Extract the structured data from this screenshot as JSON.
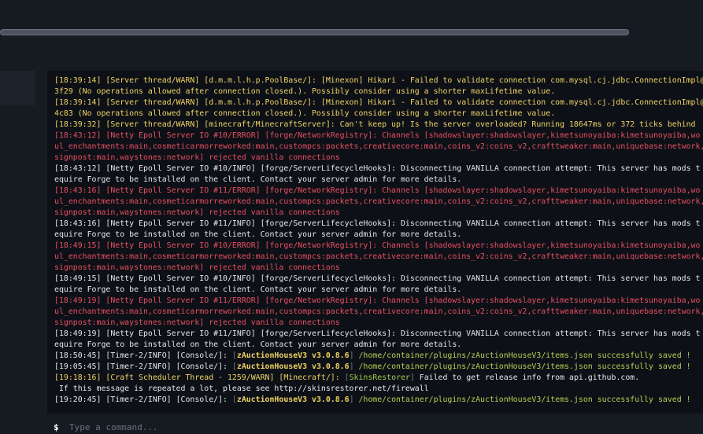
{
  "header": {
    "progress_fraction": 1.0
  },
  "console": {
    "lines": [
      {
        "kind": "warn",
        "segments": [
          {
            "text": "[18:39:14] [Server thread/WARN] [d.m.m.l.h.p.PoolBase/]: [Minexon] Hikari - Failed to validate connection com.mysql.cj.jdbc.ConnectionImpl@",
            "style": "warn"
          }
        ]
      },
      {
        "kind": "warn",
        "segments": [
          {
            "text": "3f29 (No operations allowed after connection closed.). Possibly consider using a shorter maxLifetime value.",
            "style": "warn"
          }
        ]
      },
      {
        "kind": "warn",
        "segments": [
          {
            "text": "[18:39:14] [Server thread/WARN] [d.m.m.l.h.p.PoolBase/]: [Minexon] Hikari - Failed to validate connection com.mysql.cj.jdbc.ConnectionImpl@",
            "style": "warn"
          }
        ]
      },
      {
        "kind": "warn",
        "segments": [
          {
            "text": "4c83 (No operations allowed after connection closed.). Possibly consider using a shorter maxLifetime value.",
            "style": "warn"
          }
        ]
      },
      {
        "kind": "warn",
        "segments": [
          {
            "text": "[18:39:32] [Server thread/WARN] [minecraft/MinecraftServer]: Can't keep up! Is the server overloaded? Running 18647ms or 372 ticks behind",
            "style": "warn"
          }
        ]
      },
      {
        "kind": "error",
        "segments": [
          {
            "text": "[18:43:12] [Netty Epoll Server IO #10/ERROR] [forge/NetworkRegistry]: Channels [shadowslayer:shadowslayer,kimetsunoyaiba:kimetsunoyaiba,wo",
            "style": "error"
          }
        ]
      },
      {
        "kind": "error",
        "segments": [
          {
            "text": "ul_enchantments:main,cosmeticarmorreworked:main,custompcs:packets,creativecore:main,coins_v2:coins_v2,crafttweaker:main,uniquebase:network,",
            "style": "error"
          }
        ]
      },
      {
        "kind": "error",
        "segments": [
          {
            "text": "signpost:main,waystones:network] rejected vanilla connections",
            "style": "error"
          }
        ]
      },
      {
        "kind": "info",
        "segments": [
          {
            "text": "[18:43:12] [Netty Epoll Server IO #10/INFO] [forge/ServerLifecycleHooks]: Disconnecting VANILLA connection attempt: This server has mods t",
            "style": "info"
          }
        ]
      },
      {
        "kind": "info",
        "segments": [
          {
            "text": "equire Forge to be installed on the client. Contact your server admin for more details.",
            "style": "info"
          }
        ]
      },
      {
        "kind": "error",
        "segments": [
          {
            "text": "[18:43:16] [Netty Epoll Server IO #11/ERROR] [forge/NetworkRegistry]: Channels [shadowslayer:shadowslayer,kimetsunoyaiba:kimetsunoyaiba,wo",
            "style": "error"
          }
        ]
      },
      {
        "kind": "error",
        "segments": [
          {
            "text": "ul_enchantments:main,cosmeticarmorreworked:main,custompcs:packets,creativecore:main,coins_v2:coins_v2,crafttweaker:main,uniquebase:network,",
            "style": "error"
          }
        ]
      },
      {
        "kind": "error",
        "segments": [
          {
            "text": "signpost:main,waystones:network] rejected vanilla connections",
            "style": "error"
          }
        ]
      },
      {
        "kind": "info",
        "segments": [
          {
            "text": "[18:43:16] [Netty Epoll Server IO #11/INFO] [forge/ServerLifecycleHooks]: Disconnecting VANILLA connection attempt: This server has mods t",
            "style": "info"
          }
        ]
      },
      {
        "kind": "info",
        "segments": [
          {
            "text": "equire Forge to be installed on the client. Contact your server admin for more details.",
            "style": "info"
          }
        ]
      },
      {
        "kind": "error",
        "segments": [
          {
            "text": "[18:49:15] [Netty Epoll Server IO #10/ERROR] [forge/NetworkRegistry]: Channels [shadowslayer:shadowslayer,kimetsunoyaiba:kimetsunoyaiba,wo",
            "style": "error"
          }
        ]
      },
      {
        "kind": "error",
        "segments": [
          {
            "text": "ul_enchantments:main,cosmeticarmorreworked:main,custompcs:packets,creativecore:main,coins_v2:coins_v2,crafttweaker:main,uniquebase:network,",
            "style": "error"
          }
        ]
      },
      {
        "kind": "error",
        "segments": [
          {
            "text": "signpost:main,waystones:network] rejected vanilla connections",
            "style": "error"
          }
        ]
      },
      {
        "kind": "info",
        "segments": [
          {
            "text": "[18:49:15] [Netty Epoll Server IO #10/INFO] [forge/ServerLifecycleHooks]: Disconnecting VANILLA connection attempt: This server has mods t",
            "style": "info"
          }
        ]
      },
      {
        "kind": "info",
        "segments": [
          {
            "text": "equire Forge to be installed on the client. Contact your server admin for more details.",
            "style": "info"
          }
        ]
      },
      {
        "kind": "error",
        "segments": [
          {
            "text": "[18:49:19] [Netty Epoll Server IO #11/ERROR] [forge/NetworkRegistry]: Channels [shadowslayer:shadowslayer,kimetsunoyaiba:kimetsunoyaiba,wo",
            "style": "error"
          }
        ]
      },
      {
        "kind": "error",
        "segments": [
          {
            "text": "ul_enchantments:main,cosmeticarmorreworked:main,custompcs:packets,creativecore:main,coins_v2:coins_v2,crafttweaker:main,uniquebase:network,",
            "style": "error"
          }
        ]
      },
      {
        "kind": "error",
        "segments": [
          {
            "text": "signpost:main,waystones:network] rejected vanilla connections",
            "style": "error"
          }
        ]
      },
      {
        "kind": "info",
        "segments": [
          {
            "text": "[18:49:19] [Netty Epoll Server IO #11/INFO] [forge/ServerLifecycleHooks]: Disconnecting VANILLA connection attempt: This server has mods t",
            "style": "info"
          }
        ]
      },
      {
        "kind": "info",
        "segments": [
          {
            "text": "equire Forge to be installed on the client. Contact your server admin for more details.",
            "style": "info"
          }
        ]
      },
      {
        "kind": "info",
        "segments": [
          {
            "text": "[18:50:45] [Timer-2/INFO] [Console/]: ",
            "style": "info"
          },
          {
            "text": "[",
            "style": "gray"
          },
          {
            "text": "zAuctionHouseV3 v3.0.8.6",
            "style": "plugin"
          },
          {
            "text": "] ",
            "style": "gray"
          },
          {
            "text": "/home/container/plugins/zAuctionHouseV3/items.json successfully saved !",
            "style": "path"
          }
        ]
      },
      {
        "kind": "info",
        "segments": [
          {
            "text": "[19:05:45] [Timer-2/INFO] [Console/]: ",
            "style": "info"
          },
          {
            "text": "[",
            "style": "gray"
          },
          {
            "text": "zAuctionHouseV3 v3.0.8.6",
            "style": "plugin"
          },
          {
            "text": "] ",
            "style": "gray"
          },
          {
            "text": "/home/container/plugins/zAuctionHouseV3/items.json successfully saved !",
            "style": "path"
          }
        ]
      },
      {
        "kind": "warn",
        "segments": [
          {
            "text": "[19:18:16] [Craft Scheduler Thread - 1259/WARN] [Minecraft/]: ",
            "style": "warn"
          },
          {
            "text": "[",
            "style": "gray"
          },
          {
            "text": "SkinsRestorer",
            "style": "restorer"
          },
          {
            "text": "] ",
            "style": "gray"
          },
          {
            "text": "Failed to get release info from api.github.com.",
            "style": "info"
          }
        ]
      },
      {
        "kind": "info",
        "segments": [
          {
            "text": " If this message is repeated a lot, please see http://skinsrestorer.net/firewall",
            "style": "info"
          }
        ]
      },
      {
        "kind": "info",
        "segments": [
          {
            "text": "[19:20:45] [Timer-2/INFO] [Console/]: ",
            "style": "info"
          },
          {
            "text": "[",
            "style": "gray"
          },
          {
            "text": "zAuctionHouseV3 v3.0.8.6",
            "style": "plugin"
          },
          {
            "text": "] ",
            "style": "gray"
          },
          {
            "text": "/home/container/plugins/zAuctionHouseV3/items.json successfully saved !",
            "style": "path"
          }
        ]
      }
    ]
  },
  "command": {
    "prompt": "$",
    "placeholder": "Type a command...",
    "value": ""
  },
  "colors": {
    "background": "#161b22",
    "console_bg": "#0d1117",
    "warn": "#f0d264",
    "error": "#e84e62",
    "info": "#e6e6e6",
    "path": "#b7cf53"
  }
}
